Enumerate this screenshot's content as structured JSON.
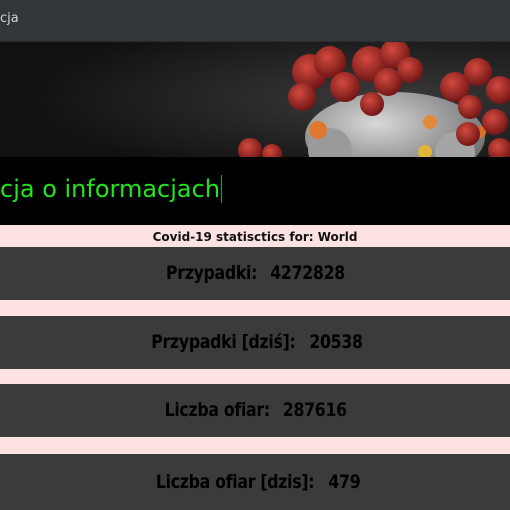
{
  "window": {
    "title": "cja"
  },
  "banner": {
    "image_name": "coronavirus-banner",
    "colors": {
      "virus": "#b32b2b",
      "background": "#1f1f1f"
    }
  },
  "marquee": {
    "text": "cja o informacjach"
  },
  "stats": {
    "header": "Covid-19 statisctics for: World",
    "items": [
      {
        "label": "Przypadki:",
        "value": "4272828"
      },
      {
        "label": "Przypadki [dziś]:",
        "value": "20538"
      },
      {
        "label": "Liczba ofiar:",
        "value": "287616"
      },
      {
        "label": "Liczba ofiar [dzis]:",
        "value": "479"
      }
    ]
  },
  "colors": {
    "card_bg": "#3b3b3b",
    "page_bg": "#fde2e2",
    "accent_green": "#22e61c",
    "titlebar": "#32363a"
  }
}
